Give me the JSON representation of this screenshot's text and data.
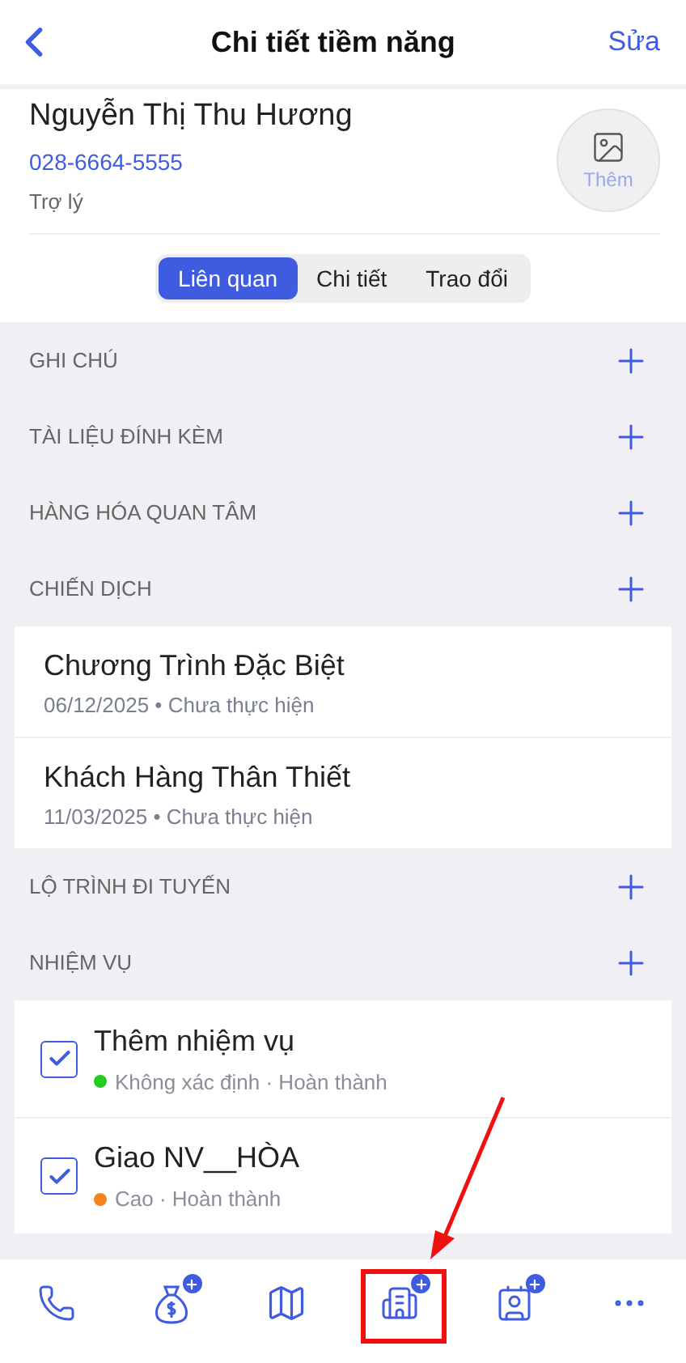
{
  "header": {
    "title": "Chi tiết tiềm năng",
    "action": "Sửa"
  },
  "profile": {
    "name": "Nguyễn Thị Thu Hương",
    "phone": "028-6664-5555",
    "position": "Trợ lý",
    "avatar_label": "Thêm"
  },
  "tabs": [
    {
      "label": "Liên quan",
      "selected": true
    },
    {
      "label": "Chi tiết",
      "selected": false
    },
    {
      "label": "Trao đổi",
      "selected": false
    }
  ],
  "sections": [
    {
      "title": "GHI CHÚ",
      "kind": "empty"
    },
    {
      "title": "TÀI LIỆU ĐÍNH KÈM",
      "kind": "empty"
    },
    {
      "title": "HÀNG HÓA QUAN TÂM",
      "kind": "empty"
    },
    {
      "title": "CHIẾN DỊCH",
      "kind": "campaigns",
      "items": [
        {
          "title": "Chương Trình Đặc Biệt",
          "meta": "06/12/2025 • Chưa thực hiện"
        },
        {
          "title": "Khách Hàng Thân Thiết",
          "meta": "11/03/2025 • Chưa thực hiện"
        }
      ]
    },
    {
      "title": "LỘ TRÌNH ĐI TUYẾN",
      "kind": "empty"
    },
    {
      "title": "NHIỆM VỤ",
      "kind": "tasks",
      "items": [
        {
          "title": "Thêm nhiệm vụ",
          "checked": true,
          "meta": "Không xác định · Hoàn thành",
          "color": "#22cc22"
        },
        {
          "title": "Giao NV__HÒA",
          "checked": true,
          "meta": "Cao · Hoàn thành",
          "color": "#f5821f"
        }
      ]
    }
  ],
  "toolbar": [
    {
      "kind": "phone"
    },
    {
      "kind": "money"
    },
    {
      "kind": "map"
    },
    {
      "kind": "building"
    },
    {
      "kind": "contact"
    },
    {
      "kind": "more"
    }
  ]
}
